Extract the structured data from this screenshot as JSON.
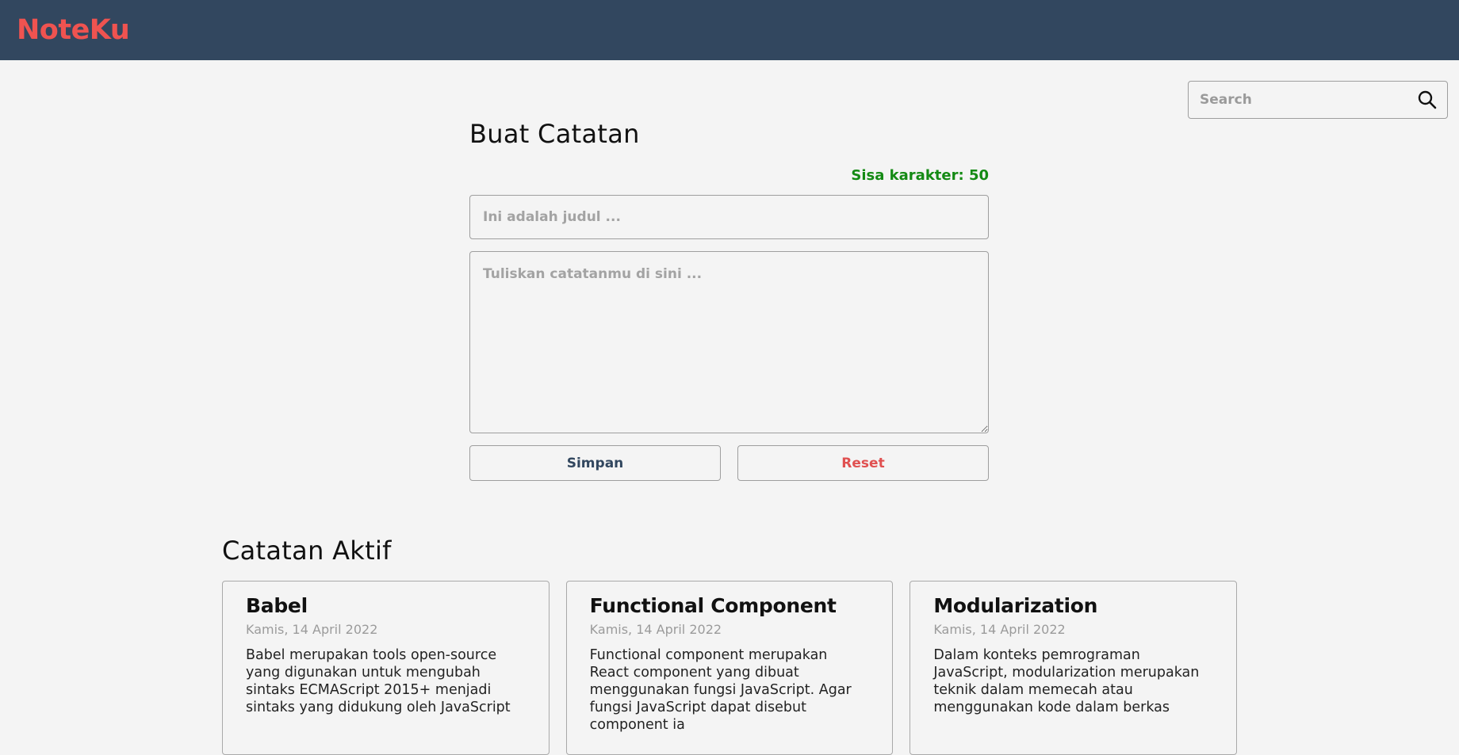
{
  "colors": {
    "header_bg": "#32475f",
    "brand": "#ef5350",
    "char_limit": "#148a14",
    "save_button_text": "#32475f",
    "reset_button_text": "#e05050"
  },
  "header": {
    "brand": "NoteKu"
  },
  "search": {
    "placeholder": "Search",
    "icon": "search-icon"
  },
  "form": {
    "title": "Buat Catatan",
    "char_limit_text": "Sisa karakter: 50",
    "title_placeholder": "Ini adalah judul ...",
    "body_placeholder": "Tuliskan catatanmu di sini ...",
    "save_label": "Simpan",
    "reset_label": "Reset"
  },
  "notes": {
    "heading": "Catatan Aktif",
    "items": [
      {
        "title": "Babel",
        "date": "Kamis, 14 April 2022",
        "body": "Babel merupakan tools open-source yang digunakan untuk mengubah sintaks ECMAScript 2015+ menjadi sintaks yang didukung oleh JavaScript"
      },
      {
        "title": "Functional Component",
        "date": "Kamis, 14 April 2022",
        "body": "Functional component merupakan React component yang dibuat menggunakan fungsi JavaScript. Agar fungsi JavaScript dapat disebut component ia"
      },
      {
        "title": "Modularization",
        "date": "Kamis, 14 April 2022",
        "body": "Dalam konteks pemrograman JavaScript, modularization merupakan teknik dalam memecah atau menggunakan kode dalam berkas"
      }
    ]
  }
}
